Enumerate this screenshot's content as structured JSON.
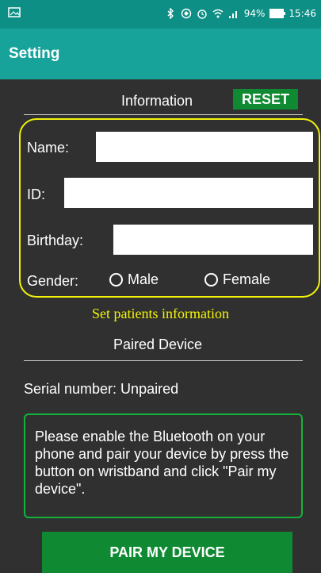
{
  "status_bar": {
    "battery_percent": "94%",
    "time": "15:46",
    "icons": [
      "gallery-icon",
      "bluetooth-icon",
      "data-saver-icon",
      "alarm-icon",
      "wifi-icon",
      "signal-icon",
      "battery-icon"
    ]
  },
  "app_bar": {
    "title": "Setting"
  },
  "information": {
    "title": "Information",
    "reset_label": "RESET",
    "fields": {
      "name": {
        "label": "Name:",
        "value": ""
      },
      "id": {
        "label": "ID:",
        "value": ""
      },
      "birthday": {
        "label": "Birthday:",
        "value": ""
      }
    },
    "gender": {
      "label": "Gender:",
      "options": [
        "Male",
        "Female"
      ],
      "selected": null
    },
    "caption": "Set patients information"
  },
  "paired_device": {
    "title": "Paired Device",
    "serial": "Serial number: Unpaired",
    "notice": "Please enable the Bluetooth on your phone and pair your device by press the button on wristband and click \"Pair my device\".",
    "button_label": "PAIR MY DEVICE"
  },
  "colors": {
    "status_bar": "#0e8f86",
    "app_bar": "#17a39a",
    "background": "#303030",
    "button_green": "#0f8a32",
    "highlight_yellow": "#f3f30a",
    "notice_border": "#12b33b"
  }
}
